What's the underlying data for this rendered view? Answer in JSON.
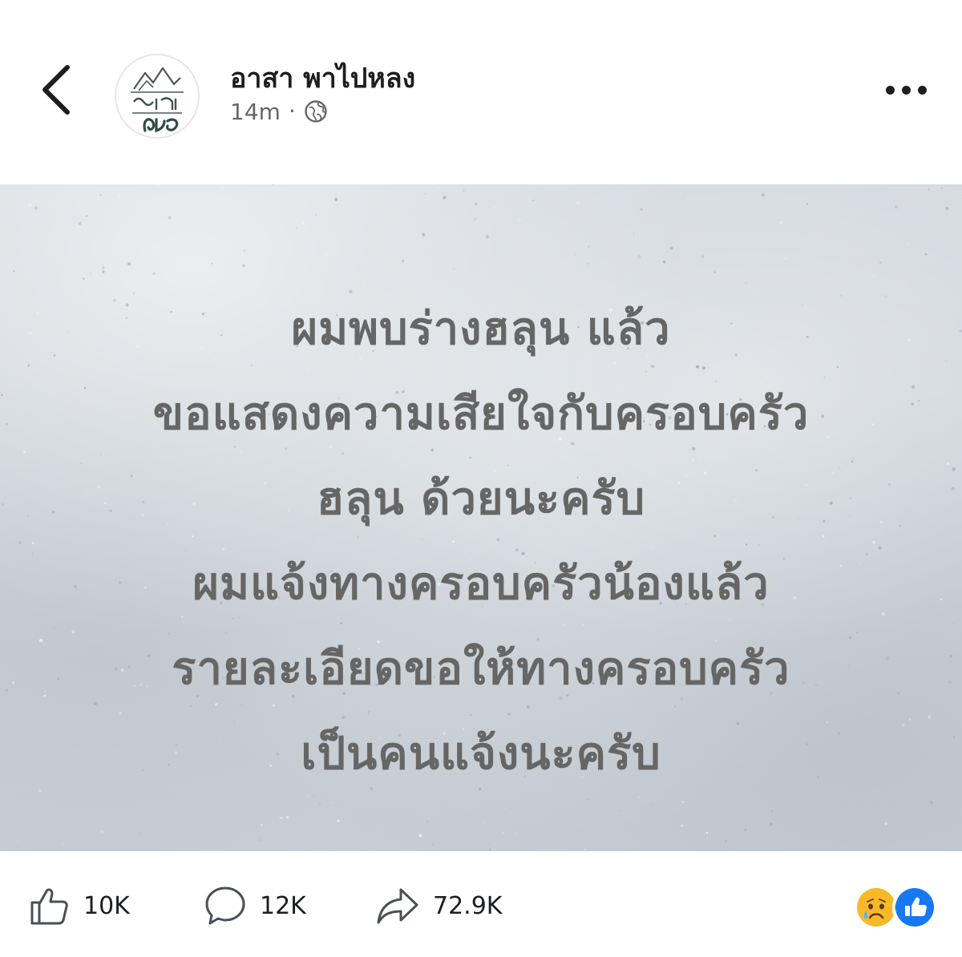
{
  "header": {
    "page_name": "อาสา พาไปหลง",
    "timestamp": "14m",
    "separator": "·",
    "audience_icon": "globe-icon",
    "back_icon": "chevron-left-icon",
    "more_icon": "more-horizontal-icon",
    "avatar_logo_text": "อาสาพาไปหลง"
  },
  "post": {
    "lines": [
      "ผมพบร่างฮลุน แล้ว",
      "ขอแสดงความเสียใจกับครอบครัว",
      "ฮลุน ด้วยนะครับ",
      "ผมแจ้งทางครอบครัวน้องแล้ว",
      "รายละเอียดขอให้ทางครอบครัว",
      "เป็นคนแจ้งนะครับ"
    ],
    "text_color": "#666666"
  },
  "actions": {
    "like": {
      "icon": "thumbs-up-icon",
      "count": "10K"
    },
    "comment": {
      "icon": "comment-icon",
      "count": "12K"
    },
    "share": {
      "icon": "share-icon",
      "count": "72.9K"
    }
  },
  "reactions": [
    {
      "icon": "sad-emoji-icon",
      "color": "#f7b125"
    },
    {
      "icon": "like-reaction-icon",
      "color": "#1877f2"
    }
  ]
}
